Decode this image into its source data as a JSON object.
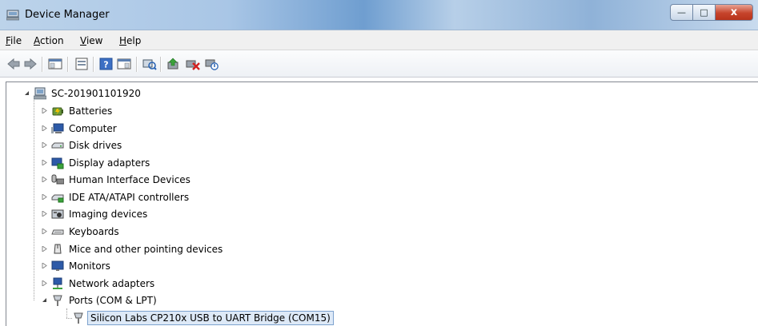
{
  "window": {
    "title": "Device Manager",
    "minimize_glyph": "—",
    "maximize_glyph": "□",
    "close_glyph": "x"
  },
  "menu": [
    {
      "key": "F",
      "rest": "ile"
    },
    {
      "key": "A",
      "rest": "ction"
    },
    {
      "key": "V",
      "rest": "iew"
    },
    {
      "key": "H",
      "rest": "elp"
    }
  ],
  "toolbar": {
    "icons": [
      "back-arrow-icon",
      "forward-arrow-icon",
      "show-hide-console-tree-icon",
      "properties-icon",
      "help-icon",
      "action-pane-icon",
      "scan-hardware-icon",
      "update-driver-icon",
      "uninstall-device-icon",
      "disable-device-icon"
    ]
  },
  "tree": {
    "root": "SC-201901101920",
    "categories": [
      {
        "label": "Batteries",
        "icon": "battery-icon",
        "expanded": false
      },
      {
        "label": "Computer",
        "icon": "computer-icon",
        "expanded": false
      },
      {
        "label": "Disk drives",
        "icon": "disk-drive-icon",
        "expanded": false
      },
      {
        "label": "Display adapters",
        "icon": "display-adapter-icon",
        "expanded": false
      },
      {
        "label": "Human Interface Devices",
        "icon": "hid-icon",
        "expanded": false
      },
      {
        "label": "IDE ATA/ATAPI controllers",
        "icon": "ide-controller-icon",
        "expanded": false
      },
      {
        "label": "Imaging devices",
        "icon": "camera-icon",
        "expanded": false
      },
      {
        "label": "Keyboards",
        "icon": "keyboard-icon",
        "expanded": false
      },
      {
        "label": "Mice and other pointing devices",
        "icon": "mouse-icon",
        "expanded": false
      },
      {
        "label": "Monitors",
        "icon": "monitor-icon",
        "expanded": false
      },
      {
        "label": "Network adapters",
        "icon": "network-adapter-icon",
        "expanded": false
      },
      {
        "label": "Ports (COM & LPT)",
        "icon": "port-icon",
        "expanded": true
      }
    ],
    "ports_children": [
      "Silicon Labs CP210x USB to UART Bridge (COM15)"
    ]
  },
  "colors": {
    "selection_border": "#7da2ce",
    "selection_fill": "#dde9f7"
  }
}
